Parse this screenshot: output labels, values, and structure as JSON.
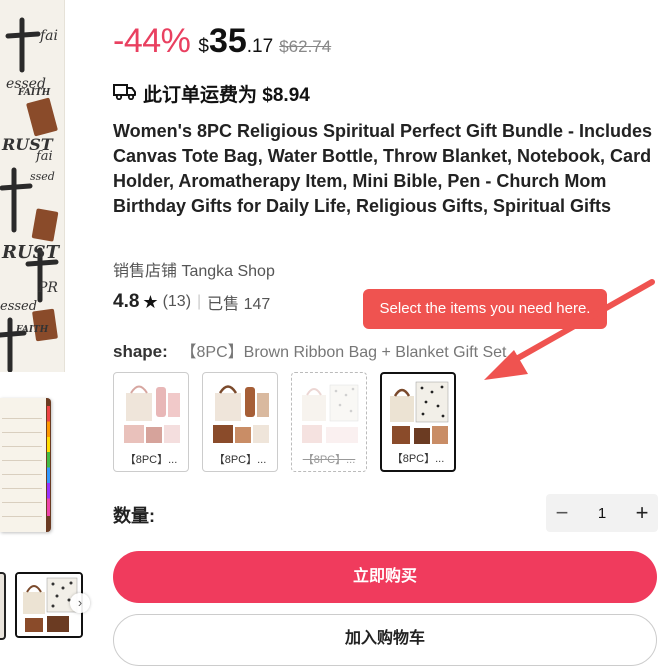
{
  "price": {
    "discount": "-44%",
    "currency": "$",
    "integer": "35",
    "decimal": ".17",
    "original": "$62.74"
  },
  "shipping": {
    "icon": "truck-icon",
    "text": "此订单运费为 $8.94"
  },
  "product": {
    "title": "Women's 8PC Religious Spiritual Perfect Gift Bundle - Includes Canvas Tote Bag, Water Bottle, Throw Blanket, Notebook, Card Holder, Aromatherapy Item, Mini Bible, Pen - Church Mom Birthday Gifts for Daily Life, Religious Gifts, Spiritual Gifts",
    "store": "销售店铺 Tangka Shop",
    "rating": "4.8",
    "reviews": "(13)",
    "sold": "已售 147"
  },
  "shape": {
    "label": "shape:",
    "value": "【8PC】Brown Ribbon Bag + Blanket Gift Set",
    "options": [
      {
        "label": "【8PC】...",
        "state": "normal"
      },
      {
        "label": "【8PC】...",
        "state": "normal"
      },
      {
        "label": "【8PC】...",
        "state": "disabled"
      },
      {
        "label": "【8PC】...",
        "state": "selected"
      }
    ]
  },
  "quantity": {
    "label": "数量:",
    "value": "1",
    "minus": "−",
    "plus": "+"
  },
  "buttons": {
    "buy_now": "立即购买",
    "add_to_cart": "加入购物车"
  },
  "annotation": {
    "text": "Select the items you need here."
  },
  "colors": {
    "accent": "#f03b5d",
    "discount": "#e94060",
    "annotation": "#ef5350"
  }
}
